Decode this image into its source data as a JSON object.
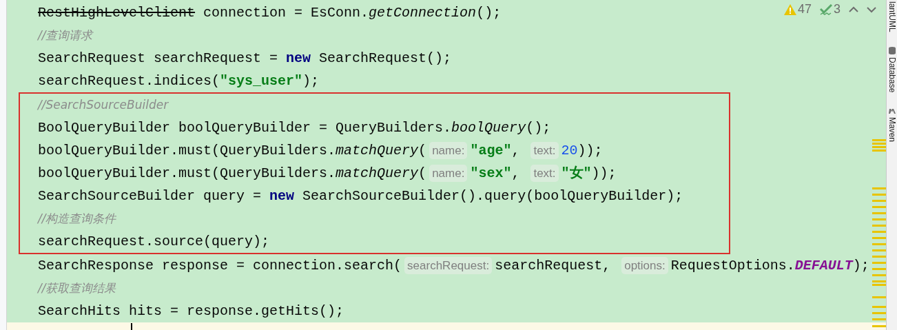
{
  "inspections": {
    "warnings": "47",
    "checks": "3"
  },
  "blocks": [
    {
      "kind": "plain",
      "lines": [
        {
          "tokens": [
            {
              "kind": "deprecated",
              "text": "RestHighLevelClient"
            },
            {
              "kind": "plain",
              "text": " connection = EsConn."
            },
            {
              "kind": "method",
              "text": "getConnection"
            },
            {
              "kind": "plain",
              "text": "();"
            }
          ]
        },
        {
          "tokens": [
            {
              "kind": "comment",
              "text": "//查询请求"
            }
          ]
        },
        {
          "tokens": [
            {
              "kind": "plain",
              "text": "SearchRequest searchRequest = "
            },
            {
              "kind": "keyword",
              "text": "new"
            },
            {
              "kind": "plain",
              "text": " SearchRequest();"
            }
          ]
        },
        {
          "tokens": [
            {
              "kind": "plain",
              "text": "searchRequest.indices("
            },
            {
              "kind": "string",
              "text": "\"sys_user\""
            },
            {
              "kind": "plain",
              "text": ");"
            }
          ]
        }
      ]
    },
    {
      "kind": "framed",
      "lines": [
        {
          "tokens": [
            {
              "kind": "comment",
              "text": "//SearchSourceBuilder"
            }
          ]
        },
        {
          "tokens": [
            {
              "kind": "plain",
              "text": "BoolQueryBuilder boolQueryBuilder = QueryBuilders."
            },
            {
              "kind": "method",
              "text": "boolQuery"
            },
            {
              "kind": "plain",
              "text": "();"
            }
          ]
        },
        {
          "tokens": [
            {
              "kind": "plain",
              "text": "boolQueryBuilder.must(QueryBuilders."
            },
            {
              "kind": "method",
              "text": "matchQuery"
            },
            {
              "kind": "plain",
              "text": "("
            },
            {
              "kind": "hint",
              "text": "name:"
            },
            {
              "kind": "string",
              "text": "\"age\""
            },
            {
              "kind": "plain",
              "text": ", "
            },
            {
              "kind": "hint",
              "text": "text:"
            },
            {
              "kind": "number",
              "text": "20"
            },
            {
              "kind": "plain",
              "text": "));"
            }
          ]
        },
        {
          "tokens": [
            {
              "kind": "plain",
              "text": "boolQueryBuilder.must(QueryBuilders."
            },
            {
              "kind": "method",
              "text": "matchQuery"
            },
            {
              "kind": "plain",
              "text": "("
            },
            {
              "kind": "hint",
              "text": "name:"
            },
            {
              "kind": "string",
              "text": "\"sex\""
            },
            {
              "kind": "plain",
              "text": ", "
            },
            {
              "kind": "hint",
              "text": "text:"
            },
            {
              "kind": "string",
              "text": "\"女\""
            },
            {
              "kind": "plain",
              "text": "));"
            }
          ]
        },
        {
          "tokens": [
            {
              "kind": "plain",
              "text": "SearchSourceBuilder query = "
            },
            {
              "kind": "keyword",
              "text": "new"
            },
            {
              "kind": "plain",
              "text": " SearchSourceBuilder().query(boolQueryBuilder);"
            }
          ]
        },
        {
          "tokens": [
            {
              "kind": "comment",
              "text": "//构造查询条件"
            }
          ]
        },
        {
          "tokens": [
            {
              "kind": "plain",
              "text": "searchRequest.source(query);"
            }
          ]
        }
      ]
    },
    {
      "kind": "plain",
      "lines": [
        {
          "tokens": [
            {
              "kind": "plain",
              "text": "SearchResponse response = connection.search("
            },
            {
              "kind": "hint",
              "text": "searchRequest:"
            },
            {
              "kind": "plain",
              "text": "searchRequest, "
            },
            {
              "kind": "hint",
              "text": "options:"
            },
            {
              "kind": "plain",
              "text": "RequestOptions."
            },
            {
              "kind": "constant",
              "text": "DEFAULT"
            },
            {
              "kind": "plain",
              "text": ");"
            }
          ]
        },
        {
          "tokens": [
            {
              "kind": "comment",
              "text": "//获取查询结果"
            }
          ]
        },
        {
          "tokens": [
            {
              "kind": "plain",
              "text": "SearchHits hits = response.getHits();"
            }
          ]
        }
      ]
    }
  ],
  "current_line": {
    "caret": true
  },
  "tool_windows": [
    {
      "label": "lantUML"
    },
    {
      "label": "Database"
    },
    {
      "label": "Maven"
    }
  ]
}
